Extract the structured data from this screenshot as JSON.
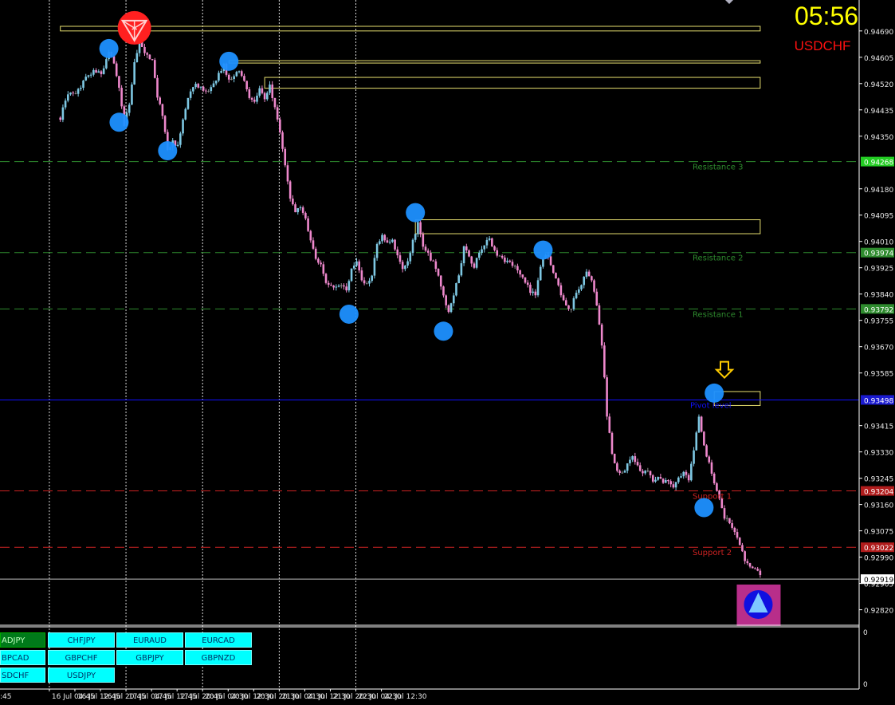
{
  "header": {
    "clock": "05:56",
    "symbol": "USDCHF"
  },
  "colors": {
    "background": "#000000",
    "grid": "#ffffff",
    "axis": "#ffffff",
    "bull": "#7ec8e3",
    "bear": "#ee88cc",
    "neutral": "#8a8a8a",
    "zone": "#e8e070",
    "swing_marker": "#1e90ff",
    "top_marker": "#ff2020",
    "resistance": "#2e8b2e",
    "pivot": "#1010ff",
    "support": "#cc2222",
    "current_price": "#c0c0c0",
    "arrow": "#ffcc00",
    "clock_text": "#ffff00",
    "symbol_text": "#ff1010",
    "pair_button": "#00ffff",
    "pair_button_active": "#007a1a"
  },
  "chart_data": {
    "type": "candlestick",
    "instrument": "USDCHF",
    "ylim": [
      0.9277,
      0.9479
    ],
    "y_ticks": [
      "0.94690",
      "0.94605",
      "0.94520",
      "0.94435",
      "0.94350",
      "0.94180",
      "0.94095",
      "0.94010",
      "0.93925",
      "0.93840",
      "0.93755",
      "0.93670",
      "0.93585",
      "0.93415",
      "0.93330",
      "0.93245",
      "0.93160",
      "0.93075",
      "0.92990",
      "0.92905",
      "0.92820"
    ],
    "x_ticks": [
      "16 Jul 04:45",
      "16 Jul 12:45",
      "16 Jul 20:45",
      "17 Jul 04:45",
      "17 Jul 12:45",
      "17 Jul 20:45",
      "20 Jul 04:30",
      "20 Jul 12:30",
      "20 Jul 20:30",
      "21 Jul 04:30",
      "21 Jul 12:30",
      "21 Jul 20:30",
      "22 Jul 04:30",
      "22 Jul 12:30"
    ],
    "x_edge_label": ":45",
    "price_path": [
      [
        0,
        0.9441
      ],
      [
        3,
        0.9449
      ],
      [
        6,
        0.9448
      ],
      [
        9,
        0.9453
      ],
      [
        13,
        0.9456
      ],
      [
        16,
        0.9455
      ],
      [
        19,
        0.9462
      ],
      [
        21,
        0.9459
      ],
      [
        23,
        0.945
      ],
      [
        25,
        0.9439
      ],
      [
        27,
        0.9445
      ],
      [
        29,
        0.9459
      ],
      [
        31,
        0.9466
      ],
      [
        33,
        0.9462
      ],
      [
        36,
        0.9459
      ],
      [
        38,
        0.9448
      ],
      [
        40,
        0.9442
      ],
      [
        42,
        0.9431
      ],
      [
        44,
        0.9433
      ],
      [
        46,
        0.9432
      ],
      [
        48,
        0.944
      ],
      [
        50,
        0.9448
      ],
      [
        53,
        0.9452
      ],
      [
        56,
        0.945
      ],
      [
        58,
        0.9449
      ],
      [
        62,
        0.9455
      ],
      [
        64,
        0.9458
      ],
      [
        66,
        0.9453
      ],
      [
        68,
        0.9455
      ],
      [
        70,
        0.9456
      ],
      [
        72,
        0.9453
      ],
      [
        74,
        0.9448
      ],
      [
        76,
        0.9446
      ],
      [
        78,
        0.945
      ],
      [
        80,
        0.9447
      ],
      [
        82,
        0.9451
      ],
      [
        84,
        0.9445
      ],
      [
        86,
        0.9436
      ],
      [
        88,
        0.9425
      ],
      [
        90,
        0.9415
      ],
      [
        92,
        0.9411
      ],
      [
        94,
        0.9412
      ],
      [
        96,
        0.9408
      ],
      [
        98,
        0.9402
      ],
      [
        100,
        0.9396
      ],
      [
        102,
        0.9393
      ],
      [
        104,
        0.9388
      ],
      [
        106,
        0.9387
      ],
      [
        108,
        0.9386
      ],
      [
        110,
        0.9387
      ],
      [
        112,
        0.9385
      ],
      [
        114,
        0.9392
      ],
      [
        116,
        0.9395
      ],
      [
        118,
        0.9388
      ],
      [
        120,
        0.9387
      ],
      [
        122,
        0.939
      ],
      [
        124,
        0.94
      ],
      [
        126,
        0.9403
      ],
      [
        128,
        0.9401
      ],
      [
        130,
        0.9402
      ],
      [
        132,
        0.9396
      ],
      [
        134,
        0.9392
      ],
      [
        136,
        0.9394
      ],
      [
        138,
        0.9401
      ],
      [
        140,
        0.9407
      ],
      [
        142,
        0.9399
      ],
      [
        144,
        0.9397
      ],
      [
        146,
        0.9394
      ],
      [
        148,
        0.939
      ],
      [
        150,
        0.9383
      ],
      [
        152,
        0.9378
      ],
      [
        154,
        0.9384
      ],
      [
        156,
        0.939
      ],
      [
        158,
        0.9399
      ],
      [
        160,
        0.9396
      ],
      [
        162,
        0.9393
      ],
      [
        164,
        0.9397
      ],
      [
        166,
        0.94
      ],
      [
        168,
        0.9402
      ],
      [
        170,
        0.9398
      ],
      [
        172,
        0.9396
      ],
      [
        174,
        0.9395
      ],
      [
        176,
        0.9394
      ],
      [
        178,
        0.9393
      ],
      [
        180,
        0.939
      ],
      [
        182,
        0.9388
      ],
      [
        184,
        0.9385
      ],
      [
        186,
        0.9384
      ],
      [
        188,
        0.9393
      ],
      [
        190,
        0.9397
      ],
      [
        192,
        0.9394
      ],
      [
        194,
        0.9389
      ],
      [
        196,
        0.9384
      ],
      [
        198,
        0.938
      ],
      [
        200,
        0.9379
      ],
      [
        202,
        0.9385
      ],
      [
        204,
        0.9387
      ],
      [
        206,
        0.9391
      ],
      [
        208,
        0.9388
      ],
      [
        210,
        0.9381
      ],
      [
        212,
        0.9368
      ],
      [
        214,
        0.9345
      ],
      [
        216,
        0.9333
      ],
      [
        218,
        0.9327
      ],
      [
        220,
        0.9326
      ],
      [
        222,
        0.9329
      ],
      [
        224,
        0.9331
      ],
      [
        226,
        0.9329
      ],
      [
        228,
        0.9326
      ],
      [
        230,
        0.9327
      ],
      [
        232,
        0.9324
      ],
      [
        234,
        0.9325
      ],
      [
        236,
        0.9323
      ],
      [
        238,
        0.9324
      ],
      [
        240,
        0.9322
      ],
      [
        242,
        0.9325
      ],
      [
        244,
        0.9326
      ],
      [
        246,
        0.9324
      ],
      [
        248,
        0.9333
      ],
      [
        250,
        0.9345
      ],
      [
        252,
        0.9335
      ],
      [
        254,
        0.9329
      ],
      [
        256,
        0.9323
      ],
      [
        258,
        0.9318
      ],
      [
        260,
        0.9312
      ],
      [
        262,
        0.931
      ],
      [
        264,
        0.9307
      ],
      [
        266,
        0.9303
      ],
      [
        268,
        0.9298
      ],
      [
        270,
        0.9296
      ],
      [
        272,
        0.9295
      ],
      [
        274,
        0.9293
      ]
    ],
    "zones": [
      {
        "start": 0,
        "end": 274,
        "top": 0.94705,
        "bottom": 0.9469
      },
      {
        "start": 66,
        "end": 274,
        "top": 0.94594,
        "bottom": 0.94588
      },
      {
        "start": 80,
        "end": 274,
        "top": 0.9454,
        "bottom": 0.94505
      },
      {
        "start": 139,
        "end": 274,
        "top": 0.9408,
        "bottom": 0.94035
      },
      {
        "start": 256,
        "end": 274,
        "top": 0.93525,
        "bottom": 0.9348
      }
    ],
    "levels": [
      {
        "name": "Resistance 3",
        "value": "0.94268",
        "role": "resistance"
      },
      {
        "name": "Resistance 2",
        "value": "0.93974",
        "role": "resistance"
      },
      {
        "name": "Resistance 1",
        "value": "0.93792",
        "role": "resistance"
      },
      {
        "name": "Pivot level",
        "value": "0.93498",
        "role": "pivot"
      },
      {
        "name": "Support 1",
        "value": "0.93204",
        "role": "support"
      },
      {
        "name": "Support 2",
        "value": "0.93022",
        "role": "support"
      }
    ],
    "current_price": "0.92919",
    "swing_points": [
      {
        "i": 19,
        "price": 0.94633
      },
      {
        "i": 23,
        "price": 0.94395
      },
      {
        "i": 42,
        "price": 0.94303
      },
      {
        "i": 66,
        "price": 0.94592
      },
      {
        "i": 113,
        "price": 0.93775
      },
      {
        "i": 139,
        "price": 0.94103
      },
      {
        "i": 150,
        "price": 0.9372
      },
      {
        "i": 189,
        "price": 0.93982
      },
      {
        "i": 252,
        "price": 0.9315
      },
      {
        "i": 256,
        "price": 0.9352
      }
    ],
    "top_marker": {
      "i": 29,
      "price": 0.947
    },
    "signal_arrow": {
      "i": 260,
      "price": 0.9358
    },
    "last_signal": {
      "i": 272,
      "price": 0.9285
    },
    "indicator_ticks": [
      "0",
      "0"
    ]
  },
  "pair_buttons": [
    {
      "label": "ADJPY",
      "active": true
    },
    {
      "label": "CHFJPY",
      "active": false
    },
    {
      "label": "EURAUD",
      "active": false
    },
    {
      "label": "EURCAD",
      "active": false
    },
    {
      "label": "BPCAD",
      "active": false
    },
    {
      "label": "GBPCHF",
      "active": false
    },
    {
      "label": "GBPJPY",
      "active": false
    },
    {
      "label": "GBPNZD",
      "active": false
    },
    {
      "label": "SDCHF",
      "active": false
    },
    {
      "label": "USDJPY",
      "active": false
    }
  ]
}
